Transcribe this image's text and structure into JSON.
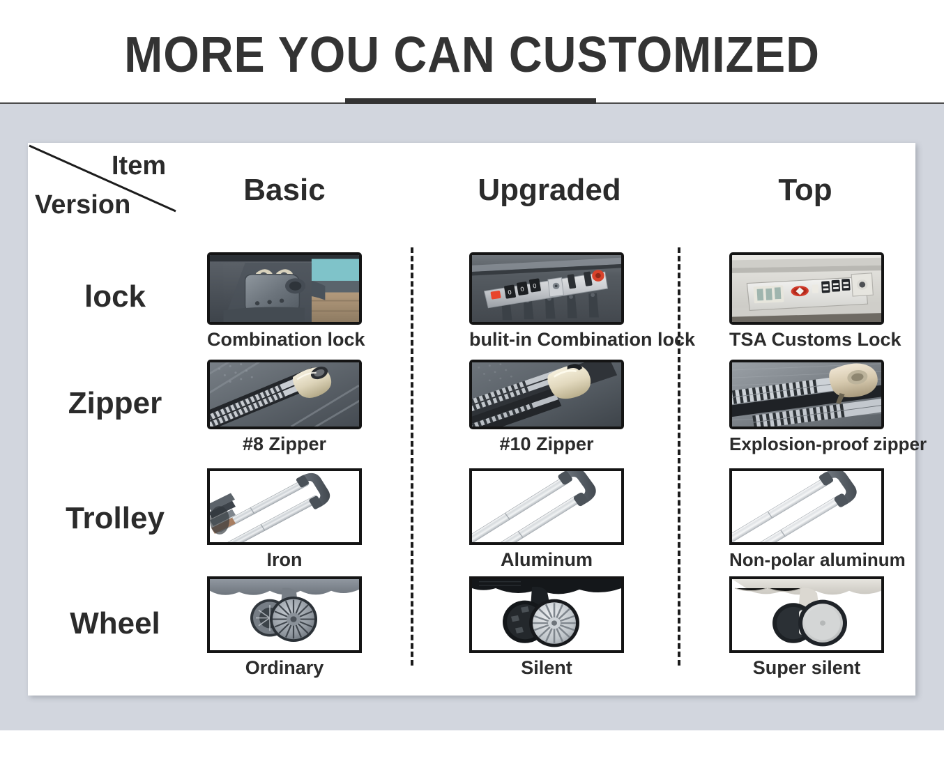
{
  "header": {
    "title": "MORE YOU CAN CUSTOMIZED"
  },
  "table": {
    "corner": {
      "item_label": "Item",
      "version_label": "Version"
    },
    "columns": [
      {
        "key": "basic",
        "label": "Basic"
      },
      {
        "key": "upgraded",
        "label": "Upgraded"
      },
      {
        "key": "top",
        "label": "Top"
      }
    ],
    "rows": [
      {
        "key": "lock",
        "label": "lock",
        "cells": [
          {
            "caption": "Combination lock",
            "image": "padlock-photo"
          },
          {
            "caption": "bulit-in Combination lock",
            "image": "builtin-combination-lock-photo"
          },
          {
            "caption": "TSA Customs Lock",
            "image": "tsa-lock-photo"
          }
        ]
      },
      {
        "key": "zipper",
        "label": "Zipper",
        "cells": [
          {
            "caption": "#8 Zipper",
            "image": "zipper-8-photo"
          },
          {
            "caption": "#10 Zipper",
            "image": "zipper-10-photo"
          },
          {
            "caption": "Explosion-proof zipper",
            "image": "explosion-proof-zipper-photo"
          }
        ]
      },
      {
        "key": "trolley",
        "label": "Trolley",
        "cells": [
          {
            "caption": "Iron",
            "image": "iron-trolley-photo"
          },
          {
            "caption": "Aluminum",
            "image": "aluminum-trolley-photo"
          },
          {
            "caption": "Non-polar aluminum",
            "image": "non-polar-aluminum-trolley-photo"
          }
        ]
      },
      {
        "key": "wheel",
        "label": "Wheel",
        "cells": [
          {
            "caption": "Ordinary",
            "image": "ordinary-wheel-photo"
          },
          {
            "caption": "Silent",
            "image": "silent-wheel-photo"
          },
          {
            "caption": "Super silent",
            "image": "super-silent-wheel-photo"
          }
        ]
      }
    ]
  },
  "colors": {
    "page_background": "#ffffff",
    "stage_background": "#d2d6de",
    "panel_background": "#ffffff",
    "text": "#2b2b2b",
    "rule": "#4a4a4a",
    "accent_bar": "#333333",
    "image_border": "#141414"
  }
}
